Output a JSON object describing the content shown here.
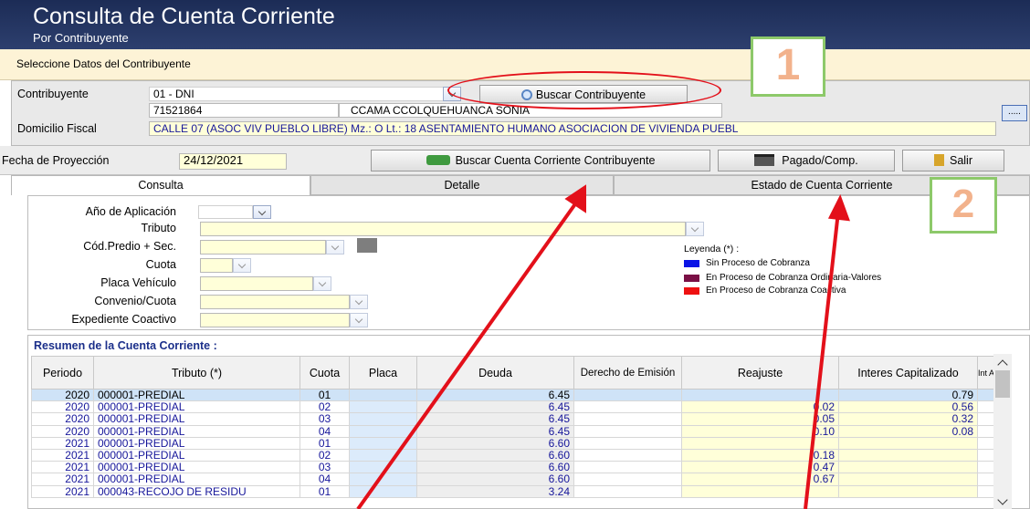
{
  "window": {
    "title": "Consulta de Cuenta Corriente",
    "subtitle": "Por Contribuyente"
  },
  "section_header": "Seleccione Datos del Contribuyente",
  "contribuyente": {
    "label": "Contribuyente",
    "doc_type": "01 - DNI",
    "doc_number": "71521864",
    "name": "CCAMA CCOLQUEHUANCA SONIA",
    "search_button": "Buscar Contribuyente",
    "domicilio_label": "Domicilio Fiscal",
    "domicilio": "CALLE 07 (ASOC VIV PUEBLO LIBRE) Mz.: O Lt.: 18 ASENTAMIENTO HUMANO ASOCIACION DE VIVIENDA PUEBL",
    "more_button": "....."
  },
  "projection": {
    "label": "Fecha de Proyección",
    "date": "24/12/2021",
    "buscar_button": "Buscar Cuenta Corriente Contribuyente",
    "pagado_button": "Pagado/Comp.",
    "salir_button": "Salir"
  },
  "tabs": [
    "Consulta",
    "Detalle",
    "Estado de Cuenta Corriente"
  ],
  "form": {
    "anio_label": "Año de Aplicación",
    "tributo_label": "Tributo",
    "predio_label": "Cód.Predio + Sec.",
    "cuota_label": "Cuota",
    "placa_label": "Placa Vehículo",
    "convenio_label": "Convenio/Cuota",
    "expediente_label": "Expediente Coactivo"
  },
  "legend": {
    "title": "Leyenda (*) :",
    "items": [
      {
        "label": "Sin Proceso de Cobranza",
        "color": "#0a14e6"
      },
      {
        "label": "En Proceso de Cobranza Ordinaria-Valores",
        "color": "#7a1045"
      },
      {
        "label": "En Proceso de Cobranza Coactiva",
        "color": "#ee1111"
      }
    ]
  },
  "grid": {
    "title": "Resumen de la Cuenta Corriente :",
    "columns": [
      "Periodo",
      "Tributo (*)",
      "Cuota",
      "Placa",
      "Deuda",
      "Derecho de Emisión",
      "Reajuste",
      "Interes Capitalizado",
      "Int Acu"
    ],
    "rows": [
      [
        "2020",
        "000001-PREDIAL",
        "01",
        "",
        "6.45",
        "",
        "",
        "0.79"
      ],
      [
        "2020",
        "000001-PREDIAL",
        "02",
        "",
        "6.45",
        "",
        "0.02",
        "0.56"
      ],
      [
        "2020",
        "000001-PREDIAL",
        "03",
        "",
        "6.45",
        "",
        "0.05",
        "0.32"
      ],
      [
        "2020",
        "000001-PREDIAL",
        "04",
        "",
        "6.45",
        "",
        "0.10",
        "0.08"
      ],
      [
        "2021",
        "000001-PREDIAL",
        "01",
        "",
        "6.60",
        "",
        "",
        ""
      ],
      [
        "2021",
        "000001-PREDIAL",
        "02",
        "",
        "6.60",
        "",
        "0.18",
        ""
      ],
      [
        "2021",
        "000001-PREDIAL",
        "03",
        "",
        "6.60",
        "",
        "0.47",
        ""
      ],
      [
        "2021",
        "000001-PREDIAL",
        "04",
        "",
        "6.60",
        "",
        "0.67",
        ""
      ],
      [
        "2021",
        "000043-RECOJO DE RESIDU",
        "01",
        "",
        "3.24",
        "",
        "",
        ""
      ]
    ]
  },
  "annotations": {
    "marker_1": "1",
    "marker_2": "2"
  }
}
